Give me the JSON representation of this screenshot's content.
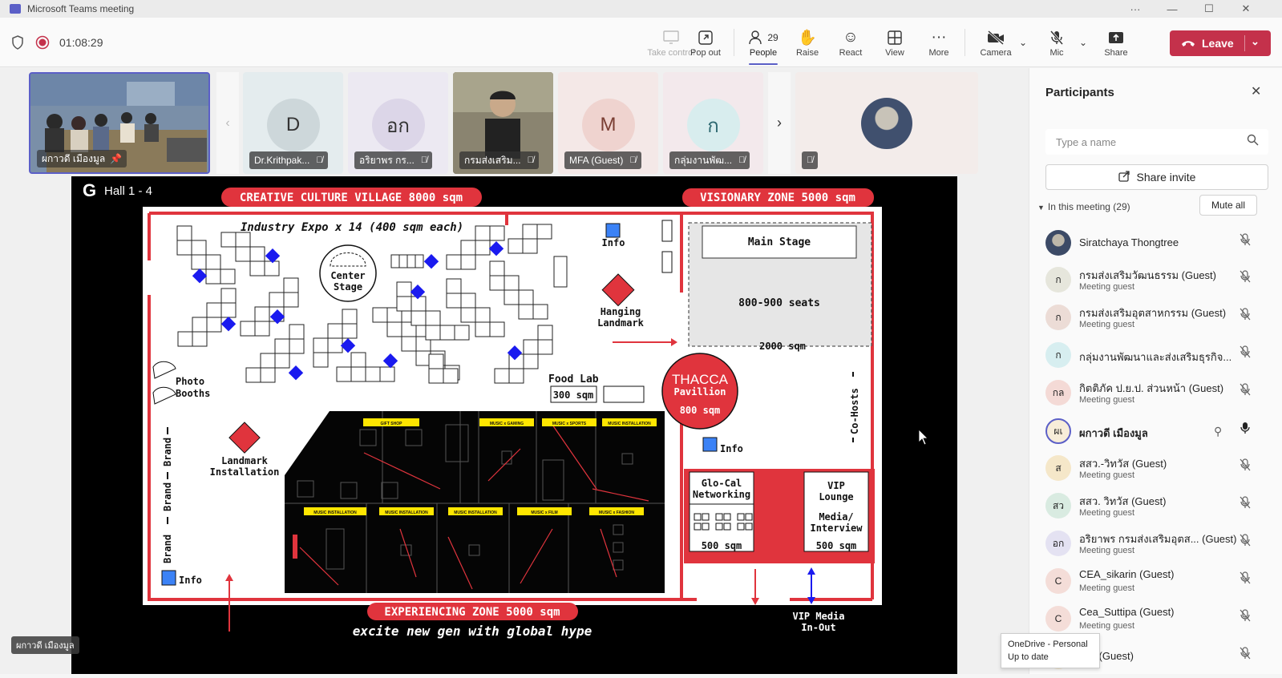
{
  "window": {
    "title": "Microsoft Teams meeting"
  },
  "toolbar": {
    "timer": "01:08:29",
    "buttons": {
      "take_control": "Take control",
      "pop_out": "Pop out",
      "people": "People",
      "people_count": "29",
      "raise": "Raise",
      "react": "React",
      "view": "View",
      "more": "More",
      "camera": "Camera",
      "mic": "Mic",
      "share": "Share",
      "leave": "Leave"
    }
  },
  "gallery": [
    {
      "name": "ผกาวดี เมืองมูล",
      "type": "video"
    },
    {
      "name": "Dr.Krithpak...",
      "initials": "D",
      "color": "#dbe7ea"
    },
    {
      "name": "อริยาพร กร...",
      "initials": "อก",
      "color": "#e8e4f0"
    },
    {
      "name": "กรมส่งเสริม...",
      "type": "video"
    },
    {
      "name": "MFA (Guest)",
      "initials": "M",
      "color": "#f5e2e0"
    },
    {
      "name": "กลุ่มงานพัฒ...",
      "initials": "ก",
      "color": "#e3efef"
    },
    {
      "name": "",
      "type": "photo"
    }
  ],
  "slide": {
    "corner_label": "Hall 1 - 4",
    "zone_top_left": "CREATIVE CULTURE VILLAGE 8000 sqm",
    "zone_top_right": "VISIONARY ZONE 5000 sqm",
    "industry_expo": "Industry Expo x 14 (400 sqm each)",
    "info": "Info",
    "center_stage_1": "Center",
    "center_stage_2": "Stage",
    "hanging_1": "Hanging",
    "hanging_2": "Landmark",
    "main_stage": "Main Stage",
    "seats": "800-900 seats",
    "sqm_2000": "2000 sqm",
    "photo_1": "Photo",
    "photo_2": "Booths",
    "food_lab": "Food Lab",
    "sqm_300": "300 sqm",
    "thacca_1": "THACCA",
    "thacca_2": "Pavillion",
    "thacca_3": "800 sqm",
    "landmark_1": "Landmark",
    "landmark_2": "Installation",
    "brand": "Brand",
    "co_hosts": "Co-Hosts",
    "glocal_1": "Glo-Cal",
    "glocal_2": "Networking",
    "sqm_500": "500 sqm",
    "vip_1": "VIP",
    "vip_2": "Lounge",
    "media_1": "Media/",
    "media_2": "Interview",
    "zone_bottom": "EXPERIENCING ZONE 5000 sqm",
    "tagline": "excite new gen with global hype",
    "vip_media_1": "VIP Media",
    "vip_media_2": "In-Out",
    "mini_labels": [
      "GIFT SHOP",
      "MUSIC x GAMING",
      "MUSIC x SPORTS",
      "MUSIC INSTALLATION",
      "MUSIC INSTALLATION",
      "MUSIC INSTALLATION",
      "MUSIC INSTALLATION",
      "MUSIC x FILM",
      "MUSIC x FASHION"
    ]
  },
  "self_label": "ผกาวดี เมืองมูล",
  "participants": {
    "title": "Participants",
    "search_placeholder": "Type a name",
    "share_invite": "Share invite",
    "in_meeting": "In this meeting (29)",
    "mute_all": "Mute all",
    "list": [
      {
        "name": "Siratchaya Thongtree",
        "sub": "",
        "avatar": "photo",
        "color": "#3c4a66"
      },
      {
        "name": "กรมส่งเสริมวัฒนธรรม (Guest)",
        "sub": "Meeting guest",
        "avatar": "ก",
        "color": "#e6e6dc"
      },
      {
        "name": "กรมส่งเสริมอุตสาหกรรม (Guest)",
        "sub": "Meeting guest",
        "avatar": "ก",
        "color": "#ecdcd6"
      },
      {
        "name": "กลุ่มงานพัฒนาและส่งเสริมธุรกิจ...",
        "sub": "",
        "avatar": "ก",
        "color": "#d7eef0"
      },
      {
        "name": "กิตติภัค ป.ย.ป. ส่วนหน้า (Guest)",
        "sub": "Meeting guest",
        "avatar": "กล",
        "color": "#f4dad6"
      },
      {
        "name": "ผกาวดี เมืองมูล",
        "sub": "",
        "avatar": "ผเ",
        "color": "#f7edd9"
      },
      {
        "name": "สสว.-วิทวัส (Guest)",
        "sub": "Meeting guest",
        "avatar": "ส",
        "color": "#f5e7c9"
      },
      {
        "name": "สสว. วิทวัส (Guest)",
        "sub": "Meeting guest",
        "avatar": "สว",
        "color": "#d9ebe1"
      },
      {
        "name": "อริยาพร กรมส่งเสริมอุตส... (Guest)",
        "sub": "Meeting guest",
        "avatar": "อก",
        "color": "#e4e2f2"
      },
      {
        "name": "CEA_sikarin (Guest)",
        "sub": "Meeting guest",
        "avatar": "C",
        "color": "#f4ddd8"
      },
      {
        "name": "Cea_Suttipa (Guest)",
        "sub": "Meeting guest",
        "avatar": "C",
        "color": "#f4ddd8"
      },
      {
        "name": "OM (Guest)",
        "sub": "",
        "avatar": "D",
        "color": "#f5e7c9"
      }
    ]
  },
  "toast": {
    "line1": "OneDrive - Personal",
    "line2": "Up to date"
  }
}
